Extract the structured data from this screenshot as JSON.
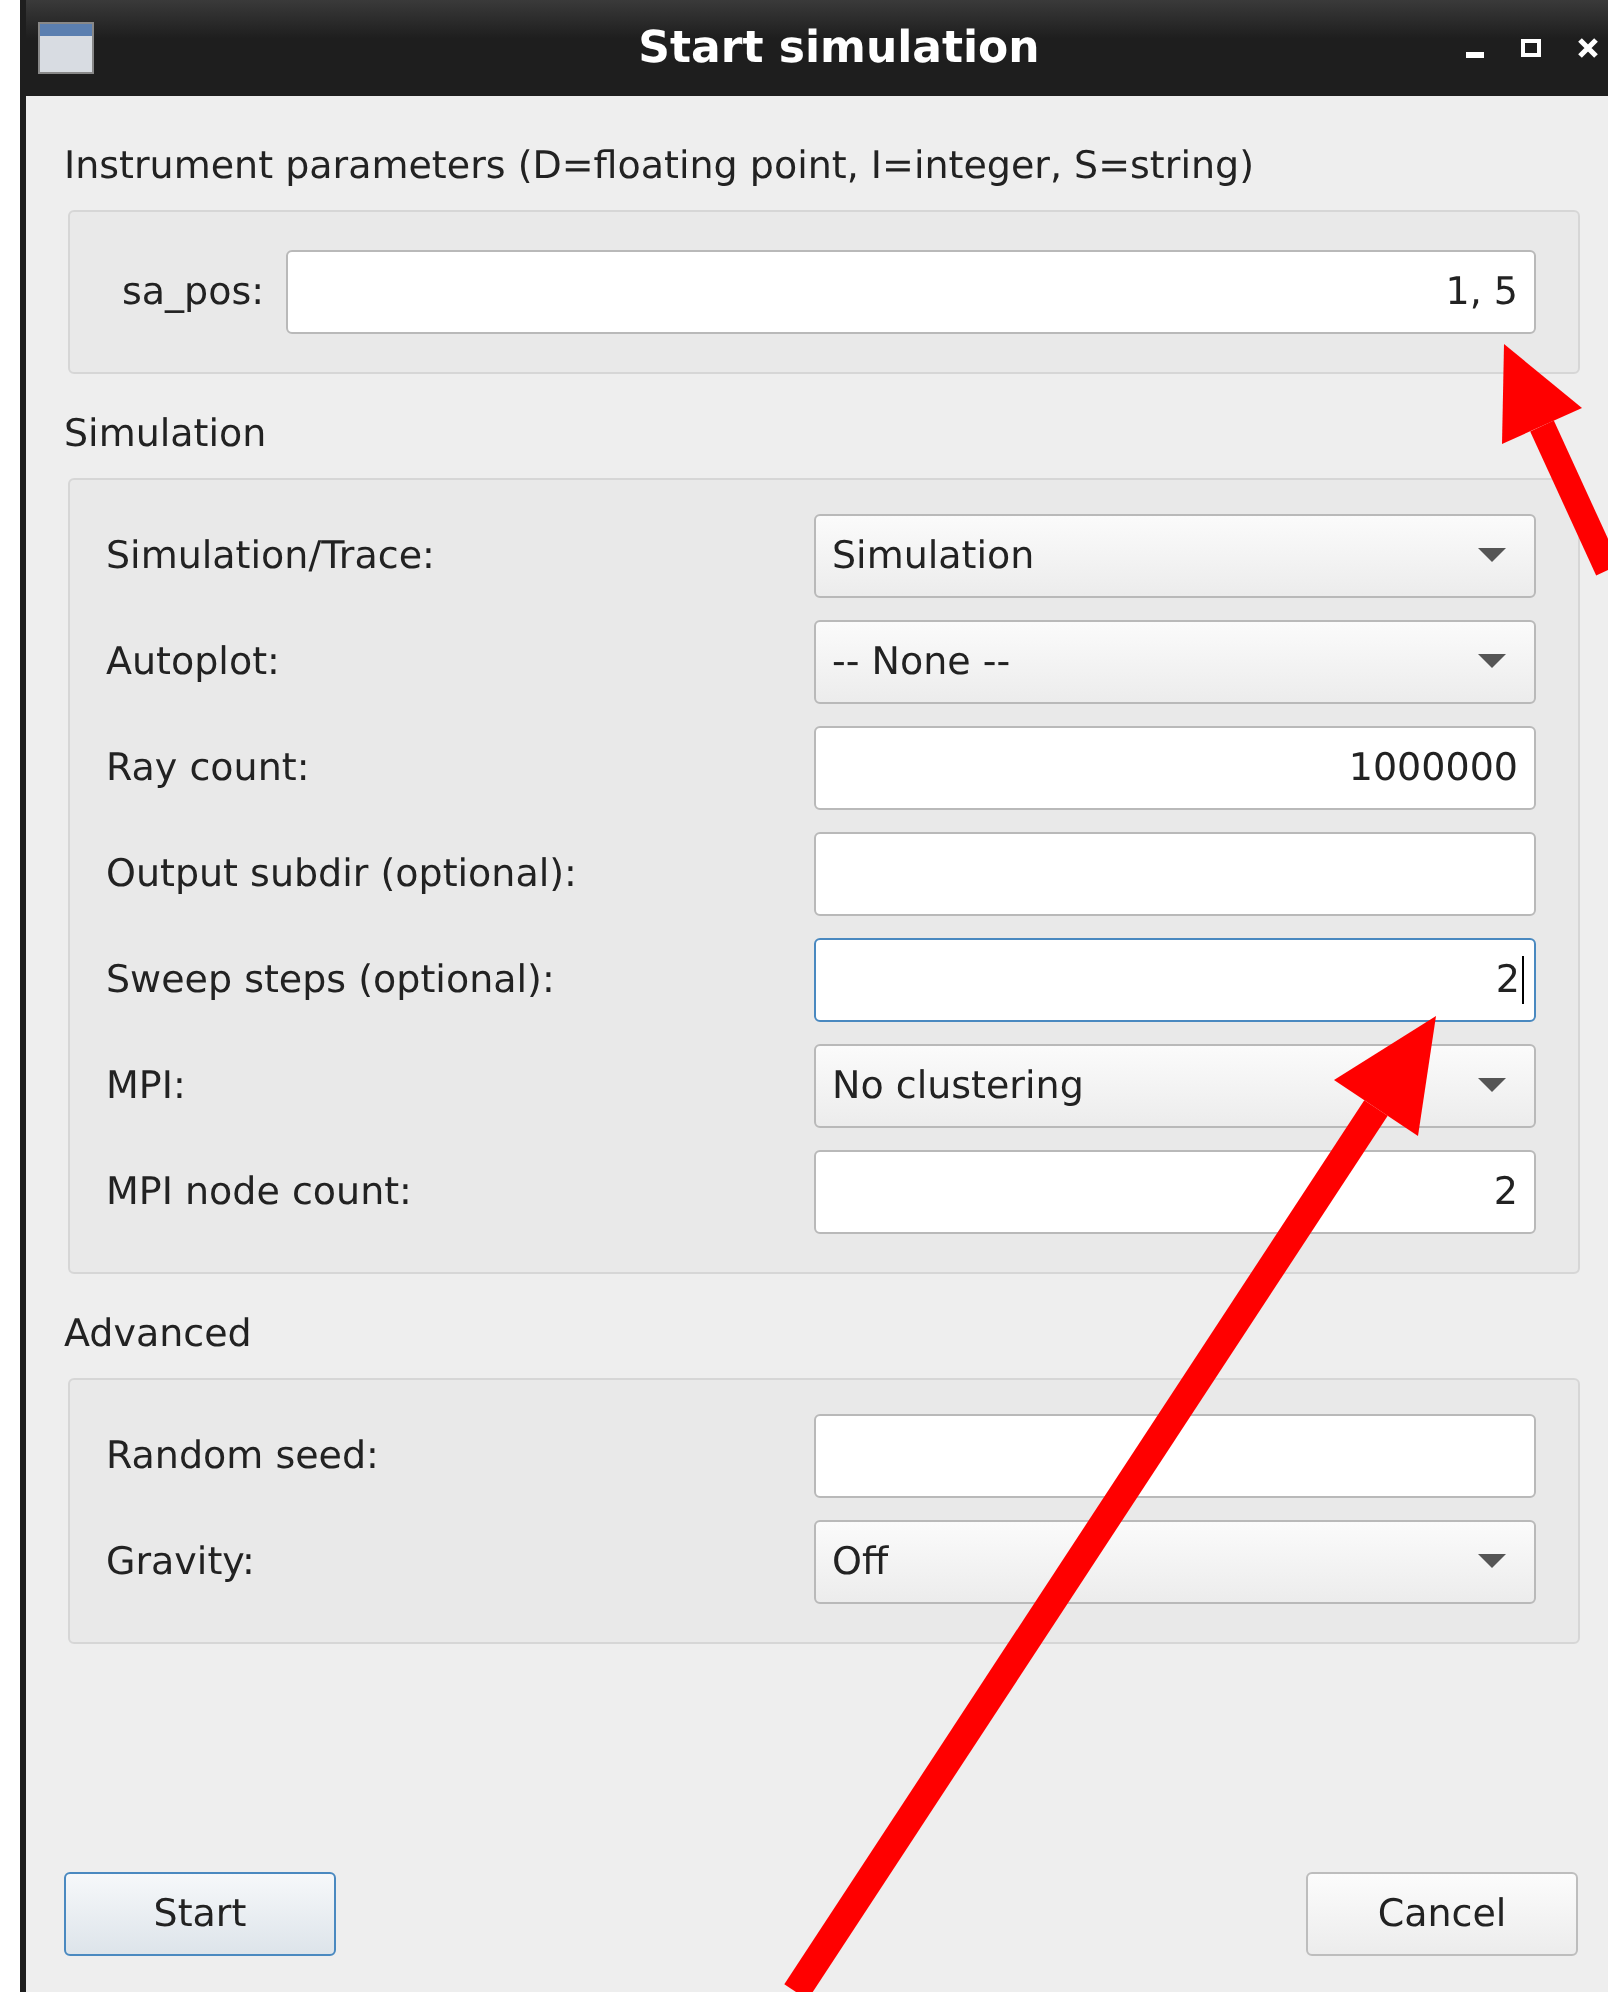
{
  "window": {
    "title": "Start simulation"
  },
  "sections": [
    {
      "title": "Instrument parameters (D=floating point, I=integer, S=string)",
      "kind": "inline",
      "fields": [
        {
          "label": "sa_pos:",
          "kind": "text",
          "value": "1, 5",
          "focused": false
        }
      ]
    },
    {
      "title": "Simulation",
      "kind": "grid",
      "fields": [
        {
          "label": "Simulation/Trace:",
          "kind": "dropdown",
          "value": "Simulation"
        },
        {
          "label": "Autoplot:",
          "kind": "dropdown",
          "value": "-- None --"
        },
        {
          "label": "Ray count:",
          "kind": "text",
          "value": "1000000",
          "focused": false
        },
        {
          "label": "Output subdir (optional):",
          "kind": "text",
          "focused": false
        },
        {
          "label": "Sweep steps (optional):",
          "kind": "text",
          "value": "2",
          "focused": true
        },
        {
          "label": "MPI:",
          "kind": "dropdown",
          "value": "No clustering"
        },
        {
          "label": "MPI node count:",
          "kind": "text",
          "value": "2",
          "focused": false
        }
      ]
    },
    {
      "title": "Advanced",
      "kind": "grid",
      "fields": [
        {
          "label": "Random seed:",
          "kind": "text",
          "focused": false
        },
        {
          "label": "Gravity:",
          "kind": "dropdown",
          "value": "Off"
        }
      ]
    }
  ],
  "buttons": [
    {
      "label": "Start",
      "default": true
    },
    {
      "label": "Cancel",
      "default": false
    }
  ]
}
